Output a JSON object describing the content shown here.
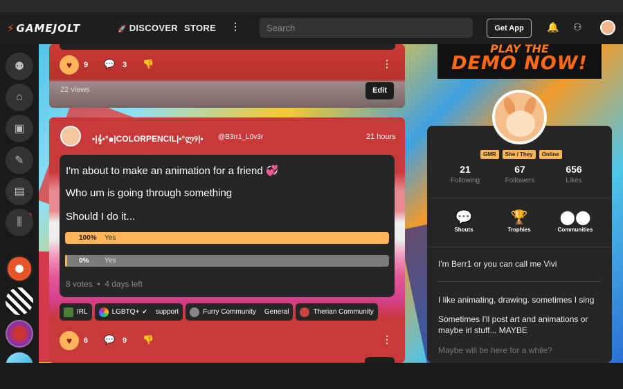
{
  "header": {
    "logo": "GAMEJOLT",
    "discover": "DISCOVER",
    "store": "STORE",
    "search_placeholder": "Search",
    "get_app": "Get App"
  },
  "post1": {
    "likes": "9",
    "comments": "3",
    "views": "22 views",
    "edit": "Edit"
  },
  "post2": {
    "name": "•|𝄞•°๑|COLORPENCIL|•°ლ୨|•",
    "handle": "@B3rr1_L0v3r",
    "time": "21 hours",
    "line1": "I'm about to make an animation for a friend",
    "heart": "💞",
    "line2": "Who um is going through something",
    "line3": "Should I do it...",
    "poll": [
      {
        "pct": "100%",
        "option": "Yes",
        "fraction": 1.0
      },
      {
        "pct": "0%",
        "option": "Yes",
        "fraction": 0.0
      }
    ],
    "votes": "8 votes",
    "left": "4 days left",
    "tags": [
      {
        "name": "IRL",
        "sub": ""
      },
      {
        "name": "LGBTQ+",
        "sub": "support"
      },
      {
        "name": "Furry Community",
        "sub": "General"
      },
      {
        "name": "Therian Community",
        "sub": ""
      }
    ],
    "likes": "6",
    "comments": "9"
  },
  "banner": {
    "line1": "PLAY THE",
    "line2": "DEMO NOW!"
  },
  "profile": {
    "badges": [
      "GMR",
      "She / They",
      "Online"
    ],
    "stats": [
      {
        "n": "21",
        "l": "Following"
      },
      {
        "n": "67",
        "l": "Followers"
      },
      {
        "n": "656",
        "l": "Likes"
      }
    ],
    "tabs": [
      "Shouts",
      "Trophies",
      "Communities"
    ],
    "bio": [
      "I'm Berr1 or you can call me Vivi",
      "I like animating, drawing. sometimes I sing",
      "Sometimes I'll post art and animations or maybe irl stuff... MAYBE",
      "Maybe will be here for a while?"
    ]
  },
  "colors": {
    "accent": "#ffb45a",
    "brand": "#ff5a1f",
    "notify": "#ff3366"
  },
  "icons": [
    "bolt-icon",
    "rocket-icon",
    "kebab-icon",
    "bell-icon",
    "friends-icon",
    "heart-icon",
    "comment-icon",
    "thumbs-down-icon",
    "shout-icon",
    "trophy-icon",
    "communities-icon"
  ]
}
